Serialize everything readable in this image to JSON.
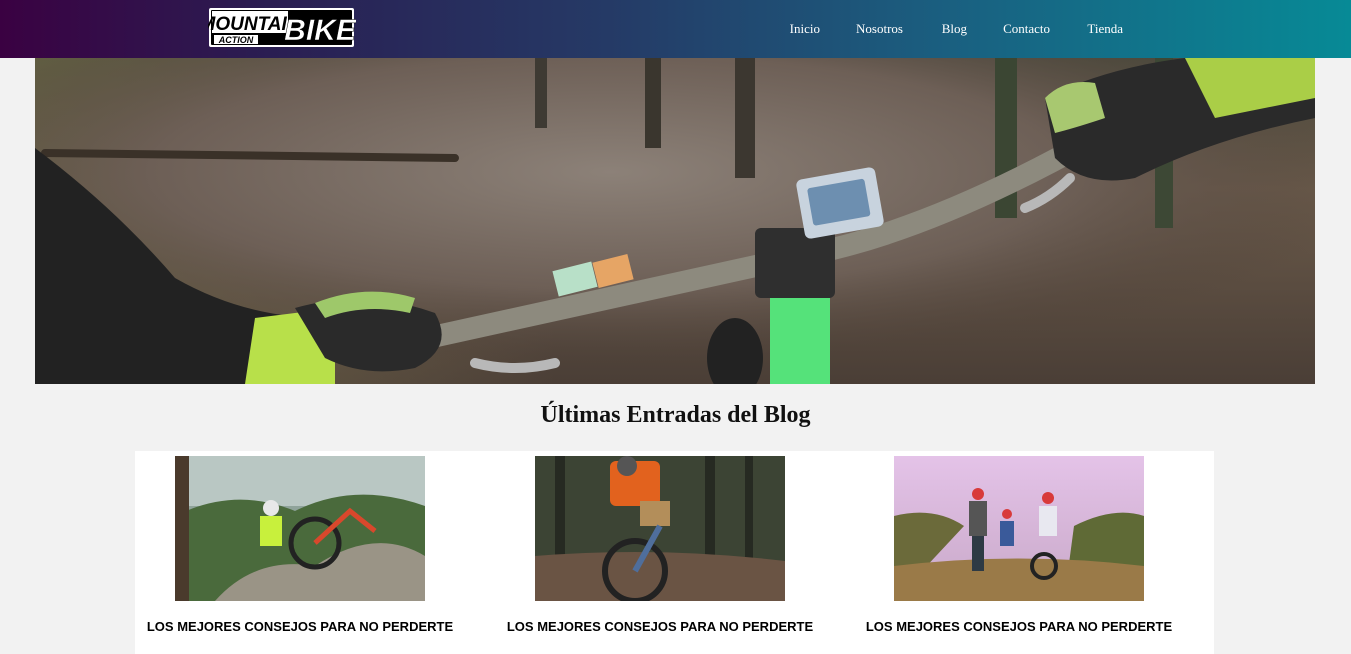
{
  "header": {
    "logo_main": "MOUNTAIN",
    "logo_accent": "BIKE",
    "logo_sub": "ACTION",
    "nav": [
      {
        "label": "Inicio"
      },
      {
        "label": "Nosotros"
      },
      {
        "label": "Blog"
      },
      {
        "label": "Contacto"
      },
      {
        "label": "Tienda"
      }
    ]
  },
  "hero": {
    "image": "mountain-bike-handlebar-trail-photo"
  },
  "blog": {
    "section_title": "Últimas Entradas del Blog",
    "posts": [
      {
        "title": "LOS MEJORES CONSEJOS PARA NO PERDERTE",
        "image": "cyclist-resting-on-rocks-photo"
      },
      {
        "title": "LOS MEJORES CONSEJOS PARA NO PERDERTE",
        "image": "cyclist-orange-jersey-trail-photo"
      },
      {
        "title": "LOS MEJORES CONSEJOS PARA NO PERDERTE",
        "image": "family-cyclists-sunset-photo"
      }
    ]
  },
  "colors": {
    "header_start": "#3a0142",
    "header_end": "#078a96",
    "page_background": "#f2f2f2"
  }
}
